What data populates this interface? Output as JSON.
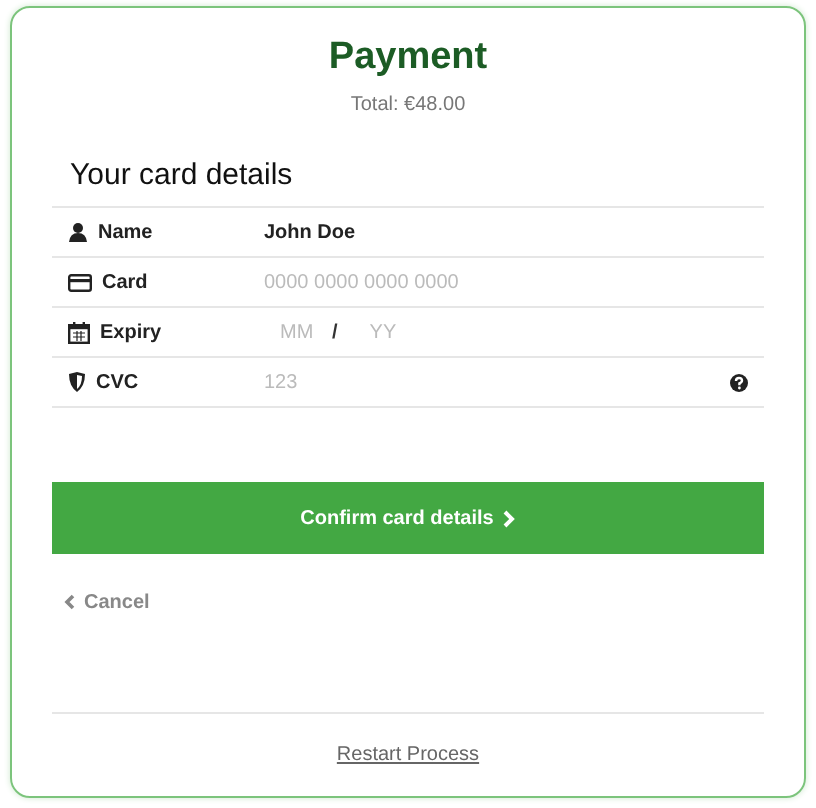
{
  "title": "Payment",
  "total": "Total: €48.00",
  "section_title": "Your card details",
  "fields": [
    {
      "kind": "name",
      "label": "Name",
      "value": "John Doe"
    },
    {
      "kind": "card",
      "label": "Card",
      "placeholder": "0000 0000 0000 0000"
    },
    {
      "kind": "expiry",
      "label": "Expiry",
      "placeholder": "MM",
      "separator": "/",
      "placeholder_2": "YY"
    },
    {
      "kind": "cvc",
      "label": "CVC",
      "placeholder": "123"
    }
  ],
  "confirm_button": "Confirm card details",
  "cancel_link": "Cancel",
  "restart_link": "Restart Process"
}
